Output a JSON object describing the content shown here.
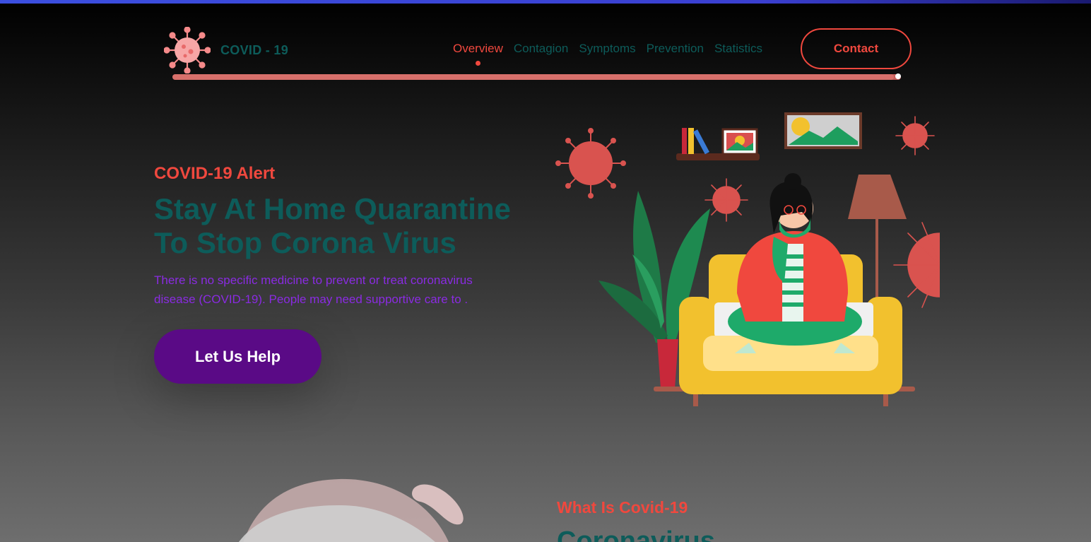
{
  "brand": {
    "name": "COVID - 19",
    "icon": "virus-icon"
  },
  "nav": {
    "items": [
      {
        "label": "Overview",
        "active": true
      },
      {
        "label": "Contagion",
        "active": false
      },
      {
        "label": "Symptoms",
        "active": false
      },
      {
        "label": "Prevention",
        "active": false
      },
      {
        "label": "Statistics",
        "active": false
      }
    ],
    "contact_label": "Contact"
  },
  "scroll_progress": 0.99,
  "hero": {
    "eyebrow": "COVID-19 Alert",
    "title": "Stay At Home Quarantine To Stop Corona Virus",
    "description": "There is no specific medicine to prevent or treat coronavirus disease (COVID-19). People may need supportive care to .",
    "cta_label": "Let Us Help",
    "illustration": "woman-on-sofa-illustration"
  },
  "about": {
    "eyebrow": "What Is Covid-19",
    "title": "Coronavirus"
  },
  "colors": {
    "accent": "#f0483e",
    "teal": "#0d5c5a",
    "purple_text": "#8a2be2",
    "cta_bg": "#5a0a86",
    "top_bar": "#3b4fe0"
  }
}
